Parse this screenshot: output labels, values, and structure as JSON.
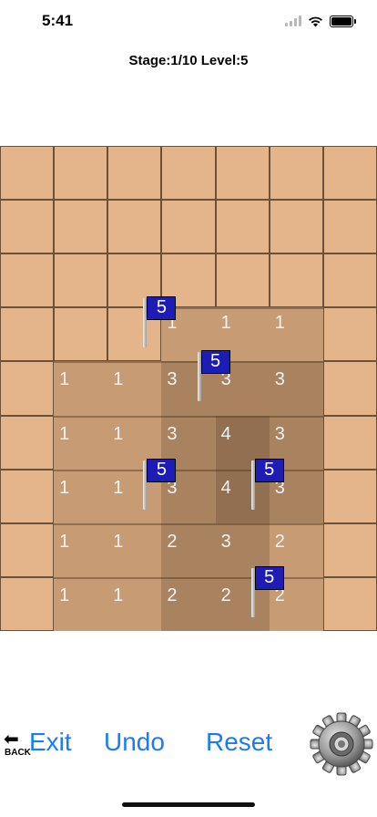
{
  "status": {
    "time": "5:41"
  },
  "header": {
    "title": "Stage:1/10 Level:5"
  },
  "board": {
    "cols": 7,
    "rows": 9,
    "revealed": [
      {
        "row": 3,
        "col": 3,
        "value": "1",
        "depth": 1
      },
      {
        "row": 3,
        "col": 4,
        "value": "1",
        "depth": 1
      },
      {
        "row": 3,
        "col": 5,
        "value": "1",
        "depth": 1
      },
      {
        "row": 4,
        "col": 1,
        "value": "1",
        "depth": 1
      },
      {
        "row": 4,
        "col": 2,
        "value": "1",
        "depth": 1
      },
      {
        "row": 4,
        "col": 3,
        "value": "3",
        "depth": 2
      },
      {
        "row": 4,
        "col": 4,
        "value": "3",
        "depth": 2
      },
      {
        "row": 4,
        "col": 5,
        "value": "3",
        "depth": 2
      },
      {
        "row": 5,
        "col": 1,
        "value": "1",
        "depth": 1
      },
      {
        "row": 5,
        "col": 2,
        "value": "1",
        "depth": 1
      },
      {
        "row": 5,
        "col": 3,
        "value": "3",
        "depth": 2
      },
      {
        "row": 5,
        "col": 4,
        "value": "4",
        "depth": 3
      },
      {
        "row": 5,
        "col": 5,
        "value": "3",
        "depth": 2
      },
      {
        "row": 6,
        "col": 1,
        "value": "1",
        "depth": 1
      },
      {
        "row": 6,
        "col": 2,
        "value": "1",
        "depth": 1
      },
      {
        "row": 6,
        "col": 3,
        "value": "3",
        "depth": 2
      },
      {
        "row": 6,
        "col": 4,
        "value": "4",
        "depth": 3
      },
      {
        "row": 6,
        "col": 5,
        "value": "3",
        "depth": 2
      },
      {
        "row": 7,
        "col": 1,
        "value": "1",
        "depth": 1
      },
      {
        "row": 7,
        "col": 2,
        "value": "1",
        "depth": 1
      },
      {
        "row": 7,
        "col": 3,
        "value": "2",
        "depth": 2
      },
      {
        "row": 7,
        "col": 4,
        "value": "3",
        "depth": 2
      },
      {
        "row": 7,
        "col": 5,
        "value": "2",
        "depth": 1
      },
      {
        "row": 8,
        "col": 1,
        "value": "1",
        "depth": 1
      },
      {
        "row": 8,
        "col": 2,
        "value": "1",
        "depth": 1
      },
      {
        "row": 8,
        "col": 3,
        "value": "2",
        "depth": 2
      },
      {
        "row": 8,
        "col": 4,
        "value": "2",
        "depth": 2
      },
      {
        "row": 8,
        "col": 5,
        "value": "2",
        "depth": 1
      }
    ],
    "flags": [
      {
        "row": 3,
        "col": 2,
        "value": "5"
      },
      {
        "row": 4,
        "col": 3,
        "value": "5"
      },
      {
        "row": 6,
        "col": 2,
        "value": "5"
      },
      {
        "row": 6,
        "col": 4,
        "value": "5"
      },
      {
        "row": 8,
        "col": 4,
        "value": "5"
      }
    ],
    "colors": {
      "covered": "#e4b48b",
      "depth1": "#c79b73",
      "depth2": "#a9825f",
      "depth3": "#916f50",
      "flag": "#1d1db5"
    }
  },
  "controls": {
    "back_label": "BACK",
    "exit_label": "Exit",
    "undo_label": "Undo",
    "reset_label": "Reset",
    "accent": "#1a7bf2"
  }
}
